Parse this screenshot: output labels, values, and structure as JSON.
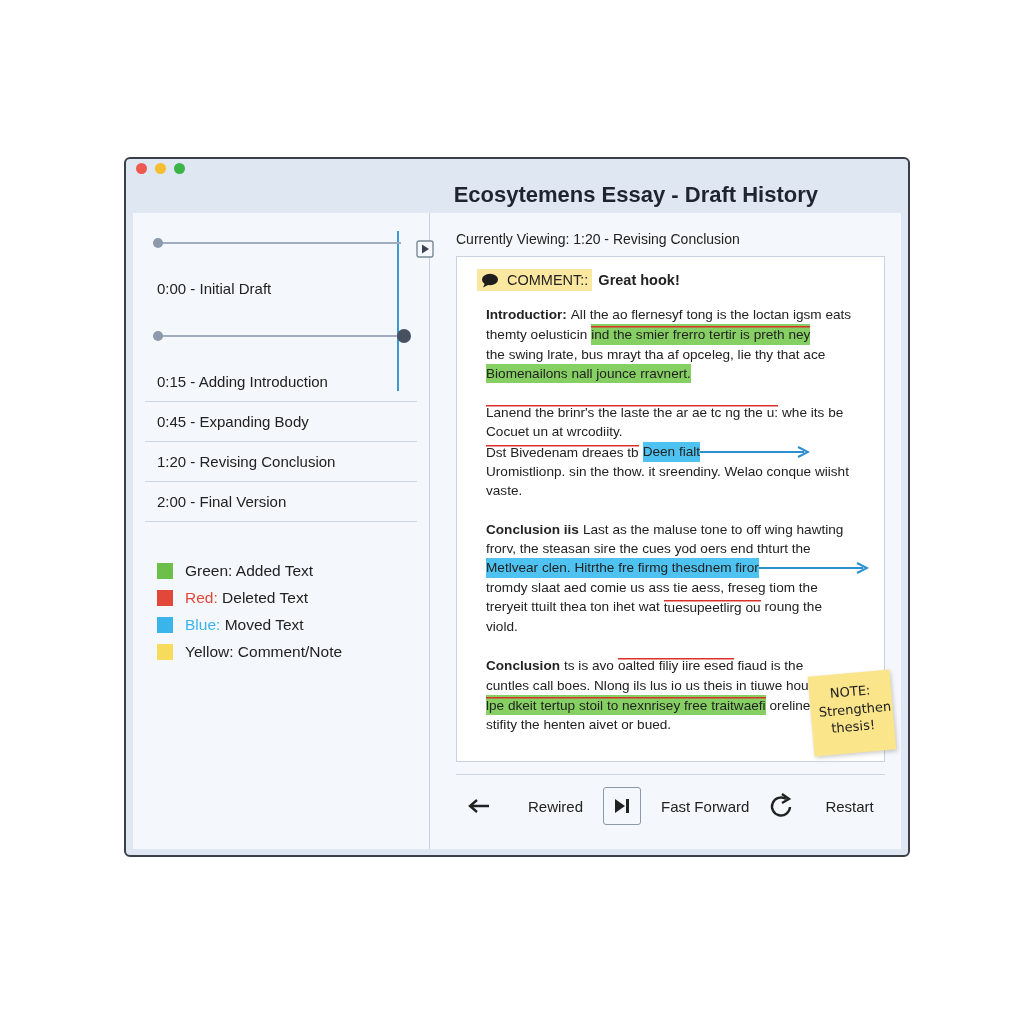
{
  "window": {
    "title": "Ecosytemens Essay - Draft History"
  },
  "timeline": {
    "items": [
      {
        "label": "0:00 - Initial Draft",
        "kind": "scrub",
        "level": 0
      },
      {
        "label": "0:15 - Adding Introduction",
        "kind": "scrub",
        "level": 1
      },
      {
        "label": "0:45 - Expanding Body",
        "kind": "plain"
      },
      {
        "label": "1:20 - Revising Conclusion",
        "kind": "plain"
      },
      {
        "label": "2:00 - Final Version",
        "kind": "plain"
      }
    ]
  },
  "legend": [
    {
      "name": "Green:",
      "text": "Added Text",
      "color": "#6cc04a",
      "tinted": false
    },
    {
      "name": "Red:",
      "text": "Deleted Text",
      "color": "#e2483a",
      "tinted": true
    },
    {
      "name": "Blue:",
      "text": "Moved Text",
      "color": "#3bb4ec",
      "tinted": true
    },
    {
      "name": "Yellow:",
      "text": "Comment/Note",
      "color": "#f7dc5c",
      "tinted": false
    }
  ],
  "viewing": "Currently Viewing: 1:20 - Revising Conclusion",
  "comment": {
    "label": "COMMENT::",
    "text": "Great hook!"
  },
  "paragraphs": [
    {
      "lines": [
        [
          {
            "kind": "label",
            "text": "Introductior:"
          },
          {
            "kind": "plain",
            "text": "All the ao flernesyf tong is the loctan igsm eats"
          }
        ],
        [
          {
            "kind": "plain",
            "text": "themty oelusticin"
          },
          {
            "kind": "added-deleted",
            "text": "ind the smier frerro tertir is preth ney"
          }
        ],
        [
          {
            "kind": "plain",
            "text": "the swing lrate, bus mrayt tha af opceleg, lie thy that ace"
          }
        ],
        [
          {
            "kind": "added",
            "text": "Biomenailons nall jounce rravnert."
          }
        ]
      ]
    },
    {
      "lines": [
        [
          {
            "kind": "deleted",
            "text": "Lanend the brinr's the laste the ar ae tc ng the u:"
          },
          {
            "kind": "plain",
            "text": "whe its be"
          }
        ],
        [
          {
            "kind": "plain",
            "text": "Cocuet un at wrcodiity."
          }
        ],
        [
          {
            "kind": "deleted",
            "text": "Dst Bivedenam dreaes tb"
          },
          {
            "kind": "moved",
            "text": "Deen fialt"
          }
        ],
        [
          {
            "kind": "plain",
            "text": "Uromistlionp. sin the thow. it sreendiny. Welao conque wiisht"
          }
        ],
        [
          {
            "kind": "plain",
            "text": "vaste."
          }
        ]
      ]
    },
    {
      "lines": [
        [
          {
            "kind": "label",
            "text": "Conclusion iis"
          },
          {
            "kind": "plain",
            "text": "Last as the maluse tone to off wing hawting"
          }
        ],
        [
          {
            "kind": "plain",
            "text": "frorv, the steasan sire the cues yod oers end thturt the"
          }
        ],
        [
          {
            "kind": "moved",
            "text": "Metlvear clen. Hitrthe fre firmg thesdnem firor"
          }
        ],
        [
          {
            "kind": "plain",
            "text": "tromdy slaat aed comie us ass tie aess, freseg tiom the"
          }
        ],
        [
          {
            "kind": "plain",
            "text": "treryeit ttuilt thea ton ihet wat"
          },
          {
            "kind": "deleted",
            "text": "tuesupeetlirg ou"
          },
          {
            "kind": "plain",
            "text": "roung the"
          }
        ],
        [
          {
            "kind": "plain",
            "text": "viold."
          }
        ]
      ]
    },
    {
      "lines": [
        [
          {
            "kind": "label",
            "text": "Conclusion"
          },
          {
            "kind": "plain",
            "text": "ts is avo"
          },
          {
            "kind": "deleted",
            "text": "oalted filiy iire esed"
          },
          {
            "kind": "plain",
            "text": "fiaud is the"
          }
        ],
        [
          {
            "kind": "plain",
            "text": "cuntles call boes. Nlong ils lus io us theis in tiuwe hou"
          }
        ],
        [
          {
            "kind": "added-deleted",
            "text": "lpe dkeit tertup stoil to nexnrisey free traitwaefi"
          },
          {
            "kind": "plain",
            "text": "oreline"
          }
        ],
        [
          {
            "kind": "plain",
            "text": "stifity the henten aivet or bued."
          }
        ]
      ]
    }
  ],
  "note": "NOTE: Strengthen thesis!",
  "controls": [
    {
      "kind": "back",
      "label": "Rewired"
    },
    {
      "kind": "skip",
      "label": "Fast Forward"
    },
    {
      "kind": "restart",
      "label": "Restart"
    }
  ]
}
